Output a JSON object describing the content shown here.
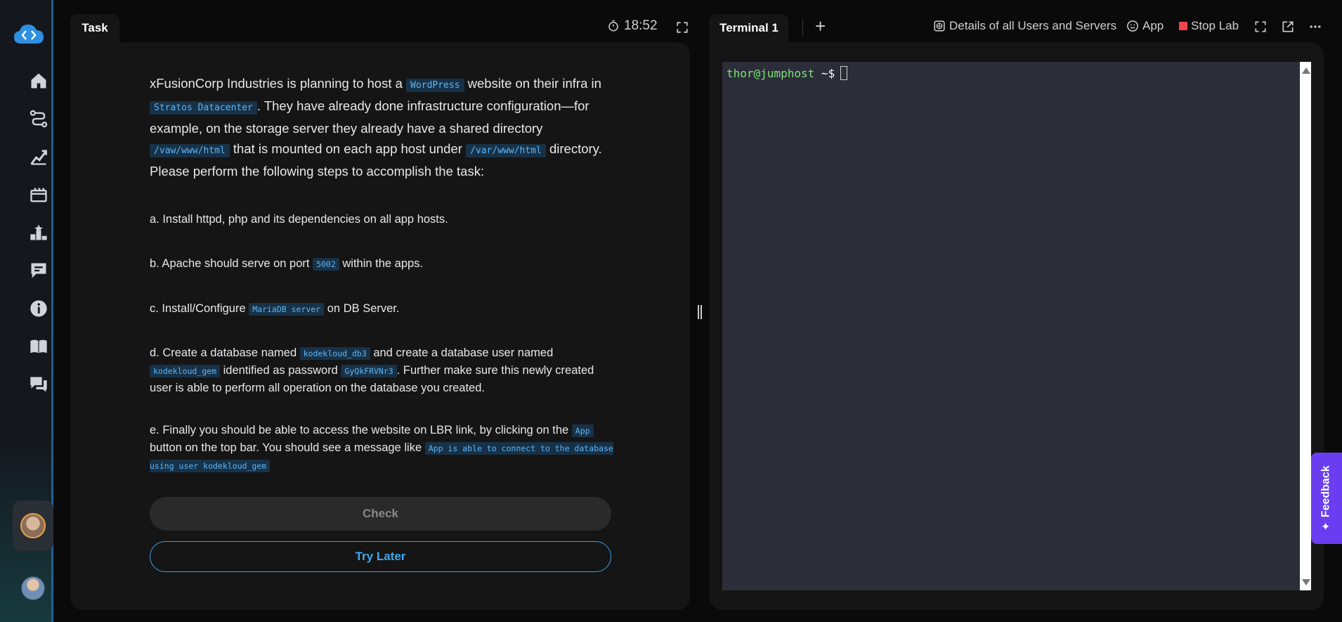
{
  "task": {
    "tab_label": "Task",
    "timer": "18:52",
    "intro": {
      "p1": "xFusionCorp Industries is planning to host a ",
      "c1": "WordPress",
      "p2": " website on their infra in ",
      "c2": "Stratos Datacenter",
      "p3": ". They have already done infrastructure configuration—for example, on the storage server they already have a shared directory ",
      "c3": "/vaw/www/html",
      "p4": " that is mounted on each app host under ",
      "c4": "/var/www/html",
      "p5": " directory. Please perform the following steps to accomplish the task:"
    },
    "steps": {
      "a": "a. Install httpd, php and its dependencies on all app hosts.",
      "b": {
        "t1": "b. Apache should serve on port ",
        "c1": "5002",
        "t2": " within the apps."
      },
      "c": {
        "t1": "c. Install/Configure ",
        "c1": "MariaDB server",
        "t2": " on DB Server."
      },
      "d": {
        "t1": "d. Create a database named ",
        "c1": "kodekloud_db3",
        "t2": " and create a database user named ",
        "c2": "kodekloud_gem",
        "t3": " identified as password ",
        "c3": "GyQkFRVNr3",
        "t4": ". Further make sure this newly created user is able to perform all operation on the database you created."
      },
      "e": {
        "t1": "e. Finally you should be able to access the website on LBR link, by clicking on the ",
        "c1": "App",
        "t2": " button on the top bar. You should see a message like ",
        "c2": "App is able to connect to the database using user kodekloud_gem"
      }
    },
    "check_label": "Check",
    "try_later_label": "Try Later"
  },
  "terminal": {
    "tab_label": "Terminal 1",
    "add_tab": "+",
    "prompt_user": "thor@jumphost",
    "prompt_sym": " ~$"
  },
  "topbar": {
    "details_label": "Details of all Users and Servers",
    "app_label": "App",
    "stop_label": "Stop Lab"
  },
  "feedback_label": "Feedback",
  "colors": {
    "accent": "#3ea8f2",
    "code_bg": "#173248",
    "code_fg": "#5eb4f4",
    "stop": "#f0454f",
    "feedback": "#6a3df0",
    "prompt": "#7fe07a"
  }
}
